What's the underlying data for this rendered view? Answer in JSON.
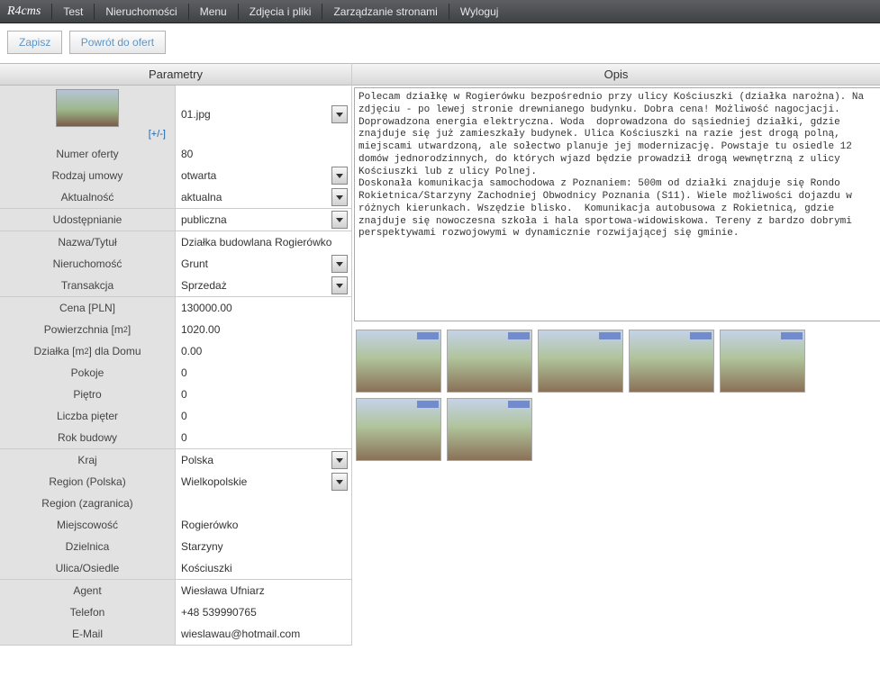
{
  "nav": {
    "logo": "R4cms",
    "items": [
      "Test",
      "Nieruchomości",
      "Menu",
      "Zdjęcia i pliki",
      "Zarządzanie stronami",
      "Wyloguj"
    ]
  },
  "actions": {
    "save": "Zapisz",
    "back": "Powrót do ofert"
  },
  "headers": {
    "params": "Parametry",
    "desc": "Opis"
  },
  "image_field": {
    "toggle": "[+/-]",
    "value": "01.jpg"
  },
  "group1": [
    {
      "label": "Numer oferty",
      "value": "80",
      "type": "text"
    },
    {
      "label": "Rodzaj umowy",
      "value": "otwarta",
      "type": "select"
    },
    {
      "label": "Aktualność",
      "value": "aktualna",
      "type": "select"
    }
  ],
  "group2": [
    {
      "label": "Udostępnianie",
      "value": "publiczna",
      "type": "select"
    }
  ],
  "group3": [
    {
      "label": "Nazwa/Tytuł",
      "value": "Działka budowlana Rogierówko",
      "type": "text"
    },
    {
      "label": "Nieruchomość",
      "value": "Grunt",
      "type": "select"
    },
    {
      "label": "Transakcja",
      "value": "Sprzedaż",
      "type": "select"
    }
  ],
  "group4": [
    {
      "label": "Cena [PLN]",
      "value": "130000.00",
      "type": "text"
    },
    {
      "label": "Powierzchnia [m²]",
      "html": "Powierzchnia [m<sup>2</sup>]",
      "value": "1020.00",
      "type": "text"
    },
    {
      "label": "Działka [m²] dla Domu",
      "html": "Działka [m<sup>2</sup>] dla Domu",
      "value": "0.00",
      "type": "text"
    },
    {
      "label": "Pokoje",
      "value": "0",
      "type": "text"
    },
    {
      "label": "Piętro",
      "value": "0",
      "type": "text"
    },
    {
      "label": "Liczba pięter",
      "value": "0",
      "type": "text"
    },
    {
      "label": "Rok budowy",
      "value": "0",
      "type": "text"
    }
  ],
  "group5": [
    {
      "label": "Kraj",
      "value": "Polska",
      "type": "select"
    },
    {
      "label": "Region (Polska)",
      "value": "Wielkopolskie",
      "type": "select"
    },
    {
      "label": "Region (zagranica)",
      "value": "",
      "type": "text"
    },
    {
      "label": "Miejscowość",
      "value": "Rogierówko",
      "type": "text"
    },
    {
      "label": "Dzielnica",
      "value": "Starzyny",
      "type": "text"
    },
    {
      "label": "Ulica/Osiedle",
      "value": "Kościuszki",
      "type": "text"
    }
  ],
  "group6": [
    {
      "label": "Agent",
      "value": "Wiesława Ufniarz",
      "type": "text"
    },
    {
      "label": "Telefon",
      "value": "+48 539990765",
      "type": "text"
    },
    {
      "label": "E-Mail",
      "value": "wieslawau@hotmail.com",
      "type": "text"
    }
  ],
  "description": "Polecam działkę w Rogierówku bezpośrednio przy ulicy Kościuszki (działka narożna). Na zdjęciu - po lewej stronie drewnianego budynku. Dobra cena! Możliwość nagocjacji.\nDoprowadzona energia elektryczna. Woda  doprowadzona do sąsiedniej działki, gdzie znajduje się już zamieszkały budynek. Ulica Kościuszki na razie jest drogą polną, miejscami utwardzoną, ale sołectwo planuje jej modernizację. Powstaje tu osiedle 12 domów jednorodzinnych, do których wjazd będzie prowadził drogą wewnętrzną z ulicy Kościuszki lub z ulicy Polnej.\nDoskonała komunikacja samochodowa z Poznaniem: 500m od działki znajduje się Rondo Rokietnica/Starzyny Zachodniej Obwodnicy Poznania (S11). Wiele możliwości dojazdu w różnych kierunkach. Wszędzie blisko.  Komunikacja autobusowa z Rokietnicą, gdzie znajduje się nowoczesna szkoła i hala sportowa-widowiskowa. Tereny z bardzo dobrymi perspektywami rozwojowymi w dynamicznie rozwijającej się gminie.",
  "gallery_count": 7
}
